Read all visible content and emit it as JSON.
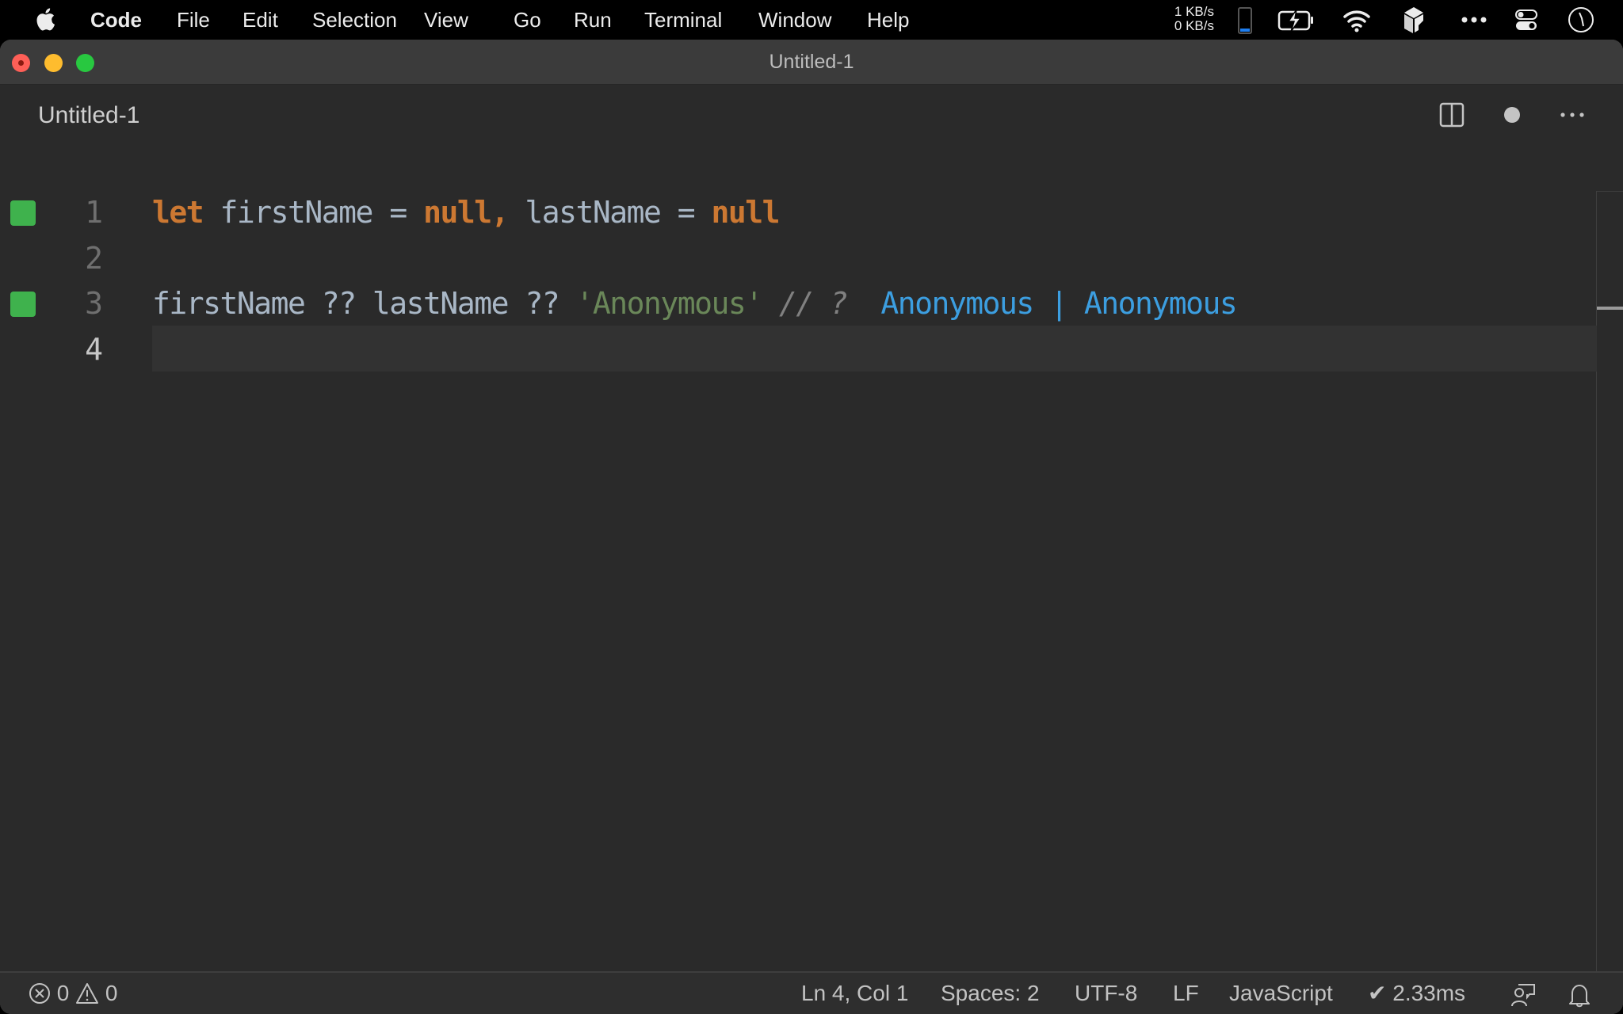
{
  "menubar": {
    "app_name": "Code",
    "items": [
      "File",
      "Edit",
      "Selection",
      "View",
      "Go",
      "Run",
      "Terminal",
      "Window",
      "Help"
    ],
    "net_up": "1 KB/s",
    "net_down": "0 KB/s",
    "tray_icons": [
      "phone-battery-icon",
      "battery-charging-icon",
      "wifi-icon",
      "app-cube-icon",
      "more-icon",
      "control-center-icon",
      "clock-icon"
    ]
  },
  "window": {
    "title": "Untitled-1"
  },
  "tab": {
    "label": "Untitled-1",
    "actions": [
      "split-editor-icon",
      "unsaved-dot-icon",
      "more-actions-icon"
    ]
  },
  "editor": {
    "lines": [
      {
        "number": "1",
        "marker": true,
        "tokens": [
          {
            "t": "let",
            "c": "kw"
          },
          {
            "t": " firstName ",
            "c": "id"
          },
          {
            "t": "=",
            "c": "op"
          },
          {
            "t": " ",
            "c": "id"
          },
          {
            "t": "null,",
            "c": "kw"
          },
          {
            "t": " lastName ",
            "c": "id"
          },
          {
            "t": "=",
            "c": "op"
          },
          {
            "t": " ",
            "c": "id"
          },
          {
            "t": "null",
            "c": "kw"
          }
        ]
      },
      {
        "number": "2",
        "marker": false,
        "tokens": []
      },
      {
        "number": "3",
        "marker": true,
        "tokens": [
          {
            "t": "firstName ",
            "c": "id"
          },
          {
            "t": "??",
            "c": "op"
          },
          {
            "t": " lastName ",
            "c": "id"
          },
          {
            "t": "??",
            "c": "op"
          },
          {
            "t": " ",
            "c": "id"
          },
          {
            "t": "'Anonymous'",
            "c": "str"
          },
          {
            "t": " // ? ",
            "c": "cm"
          },
          {
            "t": " Anonymous ",
            "c": "res"
          },
          {
            "t": "|",
            "c": "sep"
          },
          {
            "t": " Anonymous",
            "c": "res"
          }
        ]
      },
      {
        "number": "4",
        "marker": false,
        "current": true,
        "tokens": []
      }
    ]
  },
  "statusbar": {
    "errors": "0",
    "warnings": "0",
    "cursor": "Ln 4, Col 1",
    "indent": "Spaces: 2",
    "encoding": "UTF-8",
    "eol": "LF",
    "language": "JavaScript",
    "timing": "✔ 2.33ms"
  },
  "colors": {
    "keyword": "#cc7832",
    "identifier": "#a9b7c6",
    "string": "#6a8759",
    "comment": "#808080",
    "result": "#3c9ee0",
    "gutter_marker": "#3fb24d"
  }
}
